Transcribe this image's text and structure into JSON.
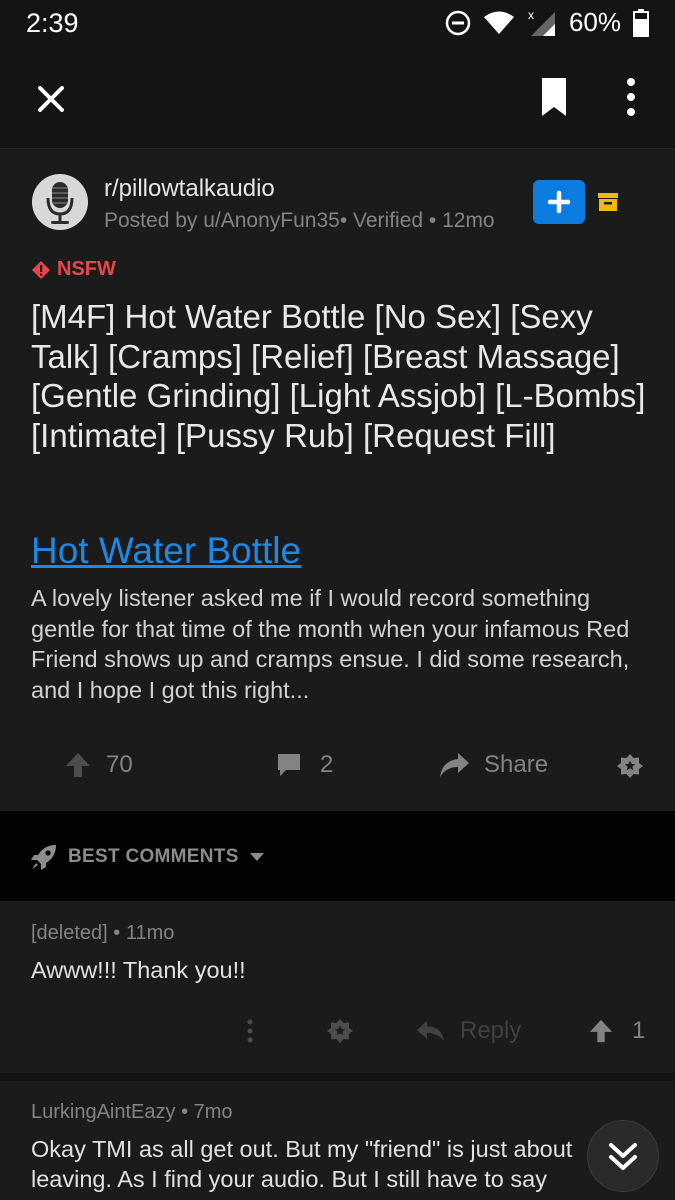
{
  "status_bar": {
    "time": "2:39",
    "battery_text": "60%",
    "icons": [
      "do-not-disturb-icon",
      "wifi-icon",
      "signal-icon",
      "battery-icon"
    ]
  },
  "toolbar": {
    "icons": [
      "close-icon",
      "bookmark-icon",
      "more-vertical-icon"
    ]
  },
  "post": {
    "subreddit": "r/pillowtalkaudio",
    "meta": "Posted by u/AnonyFun35• Verified • 12mo",
    "nsfw_label": "NSFW",
    "title": "[M4F] Hot Water Bottle [No Sex] [Sexy Talk] [Cramps] [Relief] [Breast Massage] [Gentle Grinding] [Light Assjob] [L-Bombs] [Intimate] [Pussy Rub] [Request Fill]",
    "link_text": "Hot Water Bottle",
    "body": "A lovely listener asked me if I would record something gentle for that time of the month when your infamous Red Friend shows up and cramps ensue.  I did some research, and I hope I got this right...",
    "upvotes": "70",
    "comments_count": "2",
    "share_label": "Share"
  },
  "sort": {
    "label": "BEST COMMENTS"
  },
  "comments": [
    {
      "meta": "[deleted] • 11mo",
      "body": "Awww!!! Thank you!!",
      "reply_label": "Reply",
      "votes": "1"
    },
    {
      "meta": "LurkingAintEazy • 7mo",
      "body": "Okay TMI as all get out. But my \"friend\" is just about leaving. As I find your audio. But I still have to say"
    }
  ],
  "colors": {
    "background": "#141416",
    "card": "#1b1b1c",
    "link": "#1e88e5",
    "nsfw": "#e8464a",
    "join_button": "#0d7ce0",
    "archive": "#f5b800"
  }
}
